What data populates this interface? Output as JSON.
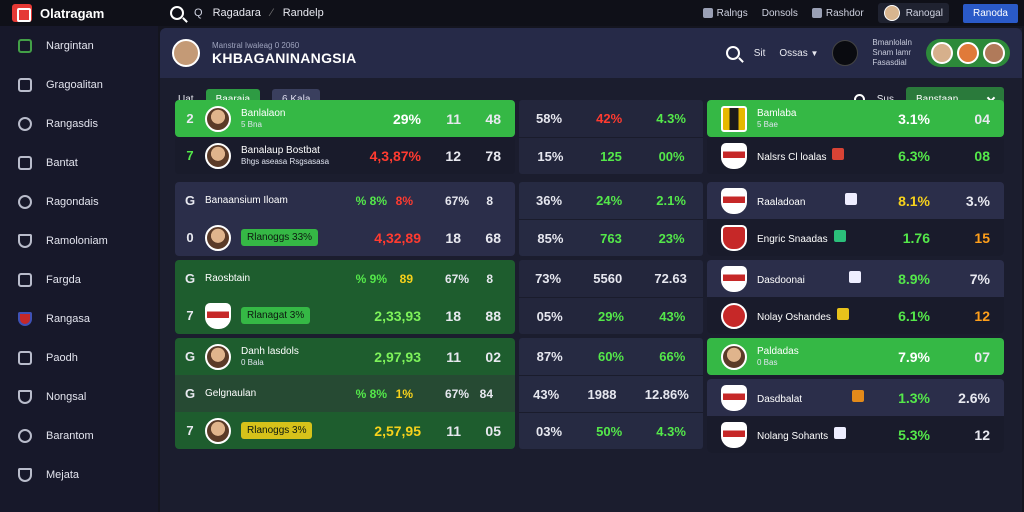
{
  "app": {
    "name": "Olatragam"
  },
  "topbar": {
    "search_q": "Q",
    "search_a": "Ragadara",
    "search_b": "Randelp",
    "link1": "Ralngs",
    "link2": "Donsols",
    "link3": "Rashdor",
    "profile": "Ranogal",
    "cta": "Ranoda"
  },
  "sidebar": {
    "items": [
      {
        "label": "Nargintan"
      },
      {
        "label": "Gragoalitan"
      },
      {
        "label": "Rangasdis"
      },
      {
        "label": "Bantat"
      },
      {
        "label": "Ragondais"
      },
      {
        "label": "Ramoloniam"
      },
      {
        "label": "Fargda"
      },
      {
        "label": "Rangasa"
      },
      {
        "label": "Paodh"
      },
      {
        "label": "Nongsal"
      },
      {
        "label": "Barantom"
      },
      {
        "label": "Mejata"
      }
    ]
  },
  "header": {
    "subtitle": "Manstral Iwaleag 0 2060",
    "title": "KHBAGANINANGSIA",
    "search_label": "Sit",
    "dropdown_label": "Ossas",
    "info1": "Bmanlolaln",
    "info2": "Snam lamr",
    "info3": "Fasasdial"
  },
  "filter": {
    "label": "Uat",
    "chip_green": "Baaraia",
    "chip_slate": "6 Kala",
    "search_label": "Sus",
    "select_value": "Banstaan"
  },
  "colA": [
    {
      "num": "2",
      "name": "Banlalaon",
      "sub": "5 Bna",
      "v1": "29%",
      "v2": "11",
      "v3": "48",
      "v1c": "wh"
    },
    {
      "num": "7",
      "name": "Banalaup Bostbat",
      "sub": "Bhgs aseasa Rsgsasasa",
      "v1": "4,3,87%",
      "v2": "12",
      "v3": "78",
      "v1c": "red"
    },
    {
      "num": "G",
      "name": "Banaansium Iloam",
      "sub": "",
      "v0a": "% 8%",
      "v0b": "8%",
      "v1": "67%",
      "v2": "8",
      "v3": "",
      "v1c": "dim"
    },
    {
      "num": "0",
      "name": "",
      "pill": "Rlanoggs 33%",
      "v1": "4,32,89",
      "v2": "18",
      "v3": "68",
      "v1c": "red"
    },
    {
      "num": "G",
      "name": "Raosbtain",
      "sub": "",
      "v0a": "% 9%",
      "v0b": "89",
      "v1": "67%",
      "v2": "8",
      "v3": "",
      "v1c": "dim"
    },
    {
      "num": "7",
      "name": "",
      "pill": "Rlanagat 3%",
      "v1": "2,33,93",
      "v2": "18",
      "v3": "88",
      "v1c": "lime"
    },
    {
      "num": "G",
      "name": "Danh lasdols",
      "sub": "0 Bala",
      "v1": "2,97,93",
      "v2": "11",
      "v3": "02",
      "v1c": "lime"
    },
    {
      "num": "G",
      "name": "Gelgnaulan",
      "sub": "",
      "v0a": "% 8%",
      "v0b": "1%",
      "v1": "67%",
      "v2": "84",
      "v3": "",
      "v1c": "dim"
    },
    {
      "num": "7",
      "name": "",
      "pill": "Rlanoggs 3%",
      "v1": "2,57,95",
      "v2": "11",
      "v3": "05",
      "v1c": "yl"
    }
  ],
  "colB": [
    {
      "a": "58%",
      "b": "42%",
      "c": "4.3%"
    },
    {
      "a": "15%",
      "b": "125",
      "c": "00%"
    },
    {
      "a": "36%",
      "b": "24%",
      "c": "2.1%"
    },
    {
      "a": "85%",
      "b": "763",
      "c": "23%"
    },
    {
      "a": "73%",
      "b": "5560",
      "c": "72.63"
    },
    {
      "a": "05%",
      "b": "29%",
      "c": "43%"
    },
    {
      "a": "87%",
      "b": "60%",
      "c": "66%"
    },
    {
      "a": "43%",
      "b": "1988",
      "c": "12.86%"
    },
    {
      "a": "03%",
      "b": "50%",
      "c": "4.3%"
    }
  ],
  "colC": [
    {
      "name": "Bamlaba",
      "sub": "5 Bae",
      "v1": "3.1%",
      "v2": "04"
    },
    {
      "name": "Nalsrs Cl loalas",
      "sub": "",
      "v1": "6.3%",
      "v2": "08"
    },
    {
      "name": "Raaladoan",
      "sub": "",
      "v1": "8.1%",
      "v2": "3.%"
    },
    {
      "name": "Engric Snaadas",
      "sub": "",
      "v1": "1.76",
      "v2": "15"
    },
    {
      "name": "Dasdoonai",
      "sub": "",
      "v1": "8.9%",
      "v2": "7%"
    },
    {
      "name": "Nolay Oshandes",
      "sub": "",
      "v1": "6.1%",
      "v2": "12"
    },
    {
      "name": "Paldadas",
      "sub": "0 Bas",
      "v1": "7.9%",
      "v2": "07"
    },
    {
      "name": "Dasdbalat",
      "sub": "",
      "v1": "1.3%",
      "v2": "2.6%"
    },
    {
      "name": "Nolang Sohants",
      "sub": "",
      "v1": "5.3%",
      "v2": "12"
    }
  ]
}
